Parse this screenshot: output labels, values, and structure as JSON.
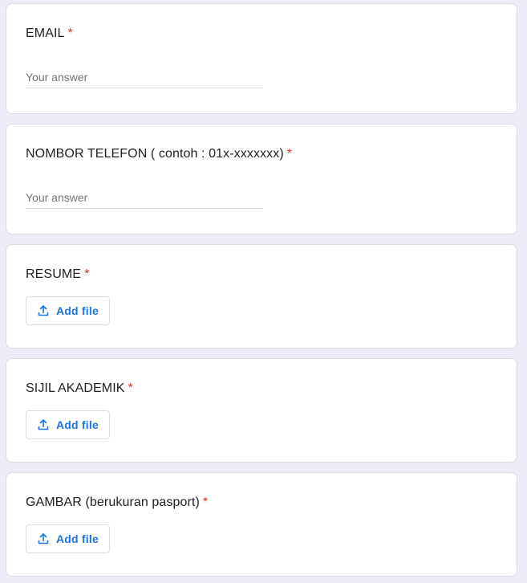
{
  "form": {
    "questions": [
      {
        "title": "EMAIL",
        "required_mark": "*",
        "type": "short-answer",
        "placeholder": "Your answer",
        "value": ""
      },
      {
        "title": "NOMBOR TELEFON ( contoh : 01x-xxxxxxx)",
        "required_mark": "*",
        "type": "short-answer",
        "placeholder": "Your answer",
        "value": ""
      },
      {
        "title": "RESUME",
        "required_mark": "*",
        "type": "file-upload",
        "button_label": "Add file",
        "button_icon": "upload-icon"
      },
      {
        "title": "SIJIL AKADEMIK",
        "required_mark": "*",
        "type": "file-upload",
        "button_label": "Add file",
        "button_icon": "upload-icon"
      },
      {
        "title": "GAMBAR (berukuran pasport)",
        "required_mark": "*",
        "type": "file-upload",
        "button_label": "Add file",
        "button_icon": "upload-icon"
      }
    ]
  },
  "colors": {
    "page_background": "#f0ebf8",
    "card_background": "#ffffff",
    "required_red": "#d93025",
    "link_blue": "#1a73e8",
    "border_gray": "#dadce0",
    "placeholder_gray": "#70757a"
  }
}
